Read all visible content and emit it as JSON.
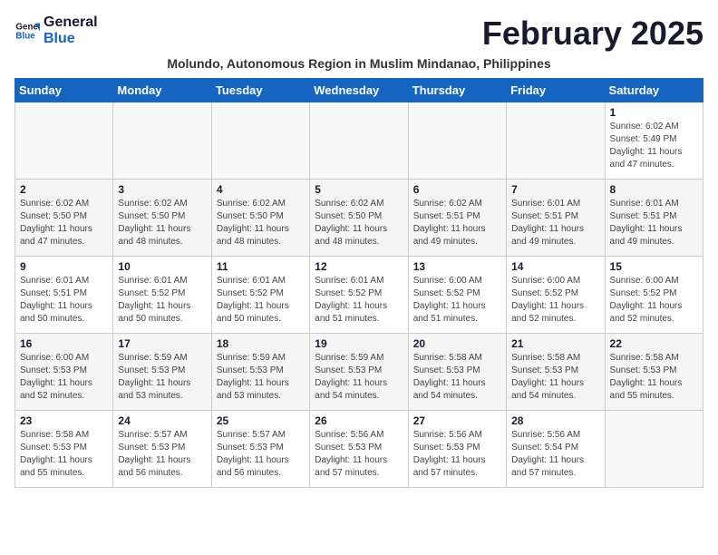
{
  "header": {
    "logo_line1": "General",
    "logo_line2": "Blue",
    "month_year": "February 2025",
    "subtitle": "Molundo, Autonomous Region in Muslim Mindanao, Philippines"
  },
  "days_of_week": [
    "Sunday",
    "Monday",
    "Tuesday",
    "Wednesday",
    "Thursday",
    "Friday",
    "Saturday"
  ],
  "weeks": [
    [
      {
        "day": "",
        "detail": ""
      },
      {
        "day": "",
        "detail": ""
      },
      {
        "day": "",
        "detail": ""
      },
      {
        "day": "",
        "detail": ""
      },
      {
        "day": "",
        "detail": ""
      },
      {
        "day": "",
        "detail": ""
      },
      {
        "day": "1",
        "detail": "Sunrise: 6:02 AM\nSunset: 5:49 PM\nDaylight: 11 hours and 47 minutes."
      }
    ],
    [
      {
        "day": "2",
        "detail": "Sunrise: 6:02 AM\nSunset: 5:50 PM\nDaylight: 11 hours and 47 minutes."
      },
      {
        "day": "3",
        "detail": "Sunrise: 6:02 AM\nSunset: 5:50 PM\nDaylight: 11 hours and 48 minutes."
      },
      {
        "day": "4",
        "detail": "Sunrise: 6:02 AM\nSunset: 5:50 PM\nDaylight: 11 hours and 48 minutes."
      },
      {
        "day": "5",
        "detail": "Sunrise: 6:02 AM\nSunset: 5:50 PM\nDaylight: 11 hours and 48 minutes."
      },
      {
        "day": "6",
        "detail": "Sunrise: 6:02 AM\nSunset: 5:51 PM\nDaylight: 11 hours and 49 minutes."
      },
      {
        "day": "7",
        "detail": "Sunrise: 6:01 AM\nSunset: 5:51 PM\nDaylight: 11 hours and 49 minutes."
      },
      {
        "day": "8",
        "detail": "Sunrise: 6:01 AM\nSunset: 5:51 PM\nDaylight: 11 hours and 49 minutes."
      }
    ],
    [
      {
        "day": "9",
        "detail": "Sunrise: 6:01 AM\nSunset: 5:51 PM\nDaylight: 11 hours and 50 minutes."
      },
      {
        "day": "10",
        "detail": "Sunrise: 6:01 AM\nSunset: 5:52 PM\nDaylight: 11 hours and 50 minutes."
      },
      {
        "day": "11",
        "detail": "Sunrise: 6:01 AM\nSunset: 5:52 PM\nDaylight: 11 hours and 50 minutes."
      },
      {
        "day": "12",
        "detail": "Sunrise: 6:01 AM\nSunset: 5:52 PM\nDaylight: 11 hours and 51 minutes."
      },
      {
        "day": "13",
        "detail": "Sunrise: 6:00 AM\nSunset: 5:52 PM\nDaylight: 11 hours and 51 minutes."
      },
      {
        "day": "14",
        "detail": "Sunrise: 6:00 AM\nSunset: 5:52 PM\nDaylight: 11 hours and 52 minutes."
      },
      {
        "day": "15",
        "detail": "Sunrise: 6:00 AM\nSunset: 5:52 PM\nDaylight: 11 hours and 52 minutes."
      }
    ],
    [
      {
        "day": "16",
        "detail": "Sunrise: 6:00 AM\nSunset: 5:53 PM\nDaylight: 11 hours and 52 minutes."
      },
      {
        "day": "17",
        "detail": "Sunrise: 5:59 AM\nSunset: 5:53 PM\nDaylight: 11 hours and 53 minutes."
      },
      {
        "day": "18",
        "detail": "Sunrise: 5:59 AM\nSunset: 5:53 PM\nDaylight: 11 hours and 53 minutes."
      },
      {
        "day": "19",
        "detail": "Sunrise: 5:59 AM\nSunset: 5:53 PM\nDaylight: 11 hours and 54 minutes."
      },
      {
        "day": "20",
        "detail": "Sunrise: 5:58 AM\nSunset: 5:53 PM\nDaylight: 11 hours and 54 minutes."
      },
      {
        "day": "21",
        "detail": "Sunrise: 5:58 AM\nSunset: 5:53 PM\nDaylight: 11 hours and 54 minutes."
      },
      {
        "day": "22",
        "detail": "Sunrise: 5:58 AM\nSunset: 5:53 PM\nDaylight: 11 hours and 55 minutes."
      }
    ],
    [
      {
        "day": "23",
        "detail": "Sunrise: 5:58 AM\nSunset: 5:53 PM\nDaylight: 11 hours and 55 minutes."
      },
      {
        "day": "24",
        "detail": "Sunrise: 5:57 AM\nSunset: 5:53 PM\nDaylight: 11 hours and 56 minutes."
      },
      {
        "day": "25",
        "detail": "Sunrise: 5:57 AM\nSunset: 5:53 PM\nDaylight: 11 hours and 56 minutes."
      },
      {
        "day": "26",
        "detail": "Sunrise: 5:56 AM\nSunset: 5:53 PM\nDaylight: 11 hours and 57 minutes."
      },
      {
        "day": "27",
        "detail": "Sunrise: 5:56 AM\nSunset: 5:53 PM\nDaylight: 11 hours and 57 minutes."
      },
      {
        "day": "28",
        "detail": "Sunrise: 5:56 AM\nSunset: 5:54 PM\nDaylight: 11 hours and 57 minutes."
      },
      {
        "day": "",
        "detail": ""
      }
    ]
  ]
}
